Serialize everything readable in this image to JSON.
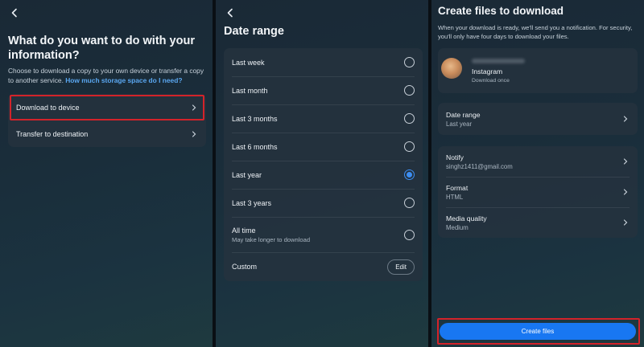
{
  "colors": {
    "accent_blue": "#1877f2",
    "radio_selected": "#3d8ef2",
    "link": "#5aa7f0",
    "highlight_red": "#d3232a"
  },
  "panel1": {
    "back_icon": "chevron-left-icon",
    "title": "What do you want to do with your information?",
    "description": "Choose to download a copy to your own device or transfer a copy to another service.",
    "storage_link": "How much storage space do I need?",
    "options": [
      {
        "label": "Download to device",
        "icon": "chevron-right-icon"
      },
      {
        "label": "Transfer to destination",
        "icon": "chevron-right-icon"
      }
    ]
  },
  "panel2": {
    "back_icon": "chevron-left-icon",
    "title": "Date range",
    "options": [
      {
        "label": "Last week",
        "selected": false
      },
      {
        "label": "Last month",
        "selected": false
      },
      {
        "label": "Last 3 months",
        "selected": false
      },
      {
        "label": "Last 6 months",
        "selected": false
      },
      {
        "label": "Last year",
        "selected": true
      },
      {
        "label": "Last 3 years",
        "selected": false
      },
      {
        "label": "All time",
        "sub": "May take longer to download",
        "selected": false
      }
    ],
    "custom": {
      "label": "Custom",
      "button": "Edit"
    }
  },
  "panel3": {
    "title": "Create files to download",
    "description": "When your download is ready, we'll send you a notification. For security, you'll only have four days to download your files.",
    "account": {
      "app": "Instagram",
      "sub": "Download once"
    },
    "date_range": {
      "label": "Date range",
      "value": "Last year"
    },
    "settings": [
      {
        "label": "Notify",
        "value": "singhz1411@gmail.com"
      },
      {
        "label": "Format",
        "value": "HTML"
      },
      {
        "label": "Media quality",
        "value": "Medium"
      }
    ],
    "create_button": "Create files"
  }
}
